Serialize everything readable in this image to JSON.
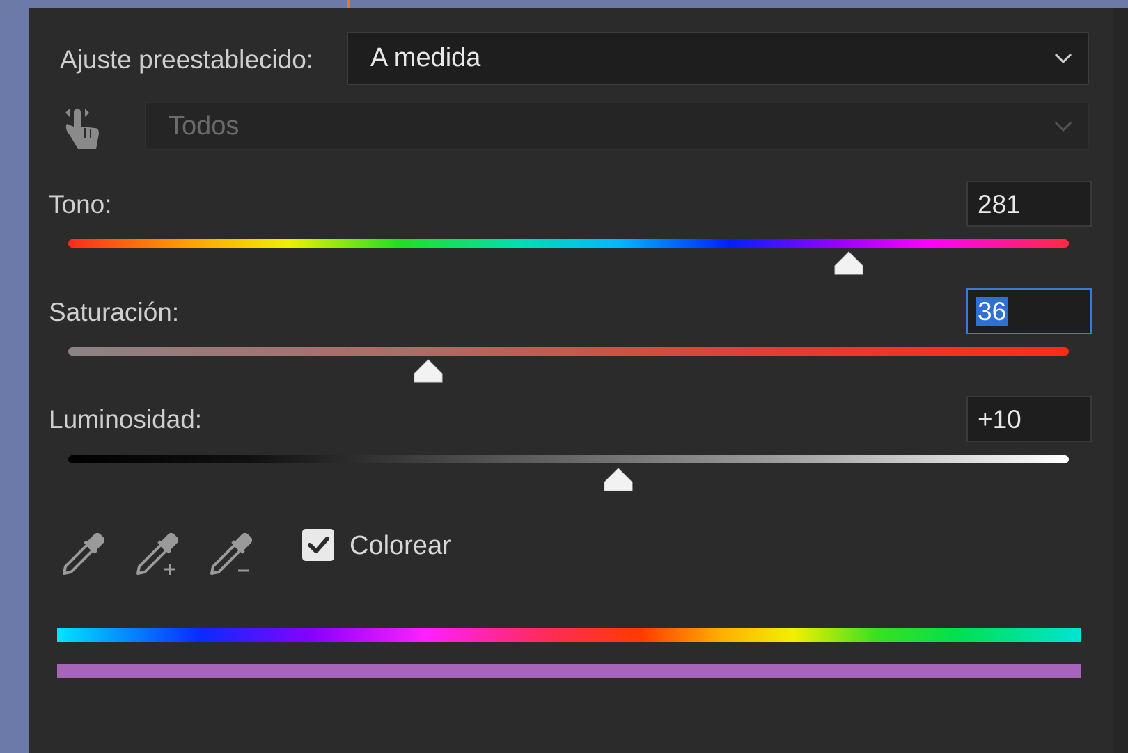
{
  "preset": {
    "label": "Ajuste preestablecido:",
    "value": "A medida"
  },
  "channel": {
    "value": "Todos",
    "enabled": false
  },
  "hue": {
    "label": "Tono:",
    "value": "281",
    "position": 0.78
  },
  "saturation": {
    "label": "Saturación:",
    "value": "36",
    "position": 0.36,
    "focused": true
  },
  "lightness": {
    "label": "Luminosidad:",
    "value": "+10",
    "position": 0.55
  },
  "tools": {
    "eyedropper": "eyedropper-icon",
    "eyedropper_add": "eyedropper-add-icon",
    "eyedropper_subtract": "eyedropper-subtract-icon",
    "targeted_adjust": "hand-targeted-adjustment-icon"
  },
  "colorize": {
    "label": "Colorear",
    "checked": true
  },
  "colors": {
    "panel": "#2b2b2b",
    "focus": "#3b7bd4",
    "result_bar": "#a764b8"
  }
}
